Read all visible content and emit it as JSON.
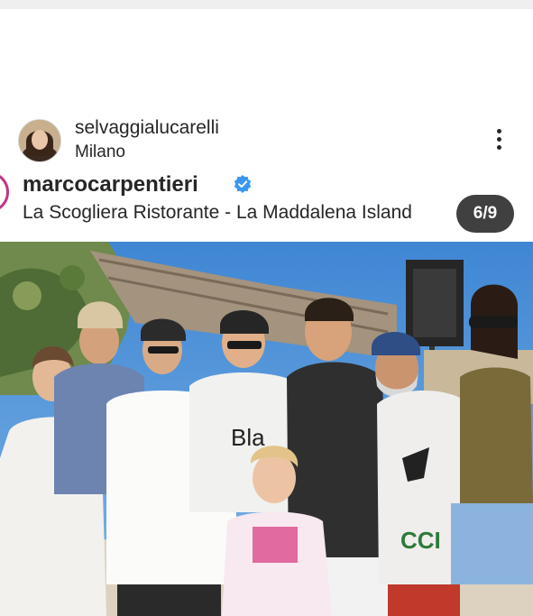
{
  "post": {
    "username": "selvaggialucarelli",
    "location": "Milano"
  },
  "embedded": {
    "username": "marcocarpentieri",
    "location": "La Scogliera Ristorante - La Maddalena Island",
    "counter": "6/9"
  },
  "photo": {
    "shirt_text_1": "Bla",
    "shirt_text_2": "CCI"
  },
  "icons": {
    "more": "more-vertical-icon",
    "verified": "verified-badge-icon"
  },
  "colors": {
    "verified_blue": "#3897f0",
    "ring_pink": "#c13584",
    "sky": "#4a8fd6"
  }
}
